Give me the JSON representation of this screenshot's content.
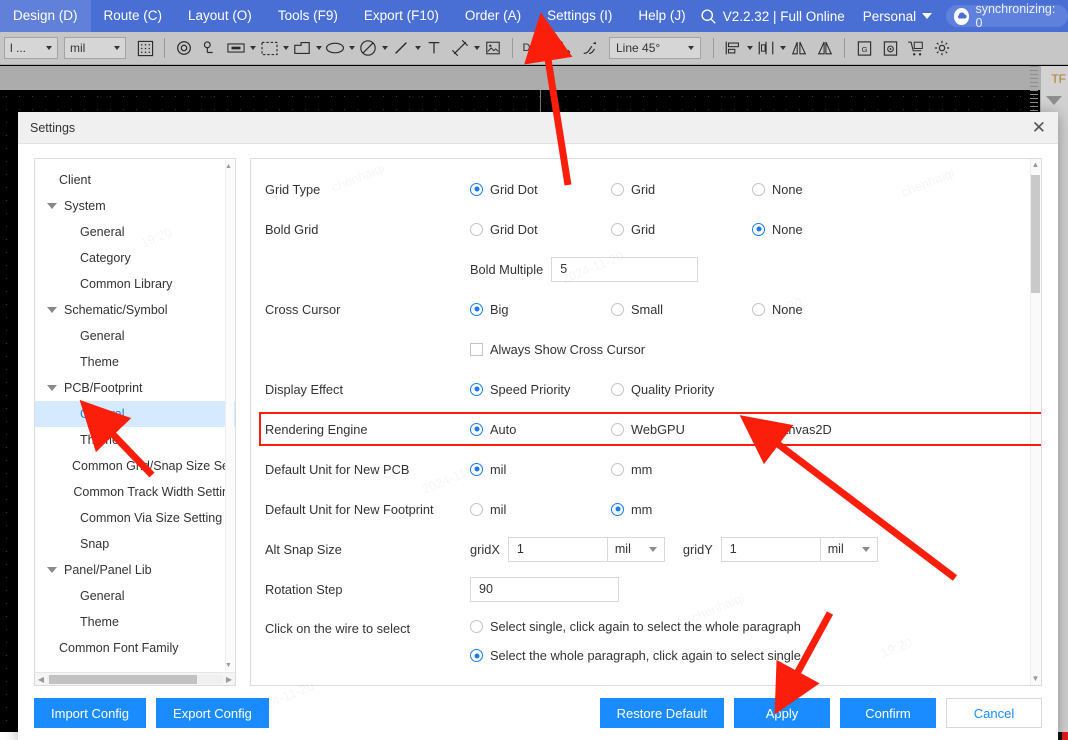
{
  "menubar": {
    "items": [
      {
        "label": "Design (D)",
        "name": "menu-design"
      },
      {
        "label": "Route (C)",
        "name": "menu-route"
      },
      {
        "label": "Layout (O)",
        "name": "menu-layout"
      },
      {
        "label": "Tools (F9)",
        "name": "menu-tools"
      },
      {
        "label": "Export (F10)",
        "name": "menu-export"
      },
      {
        "label": "Order (A)",
        "name": "menu-order"
      },
      {
        "label": "Settings (I)",
        "name": "menu-settings"
      },
      {
        "label": "Help (J)",
        "name": "menu-help"
      }
    ],
    "search_icon": "search-icon",
    "version": "V2.2.32 | Full Online",
    "account": "Personal",
    "sync_status": "synchronizing: 0",
    "accent": "#4a6fd4"
  },
  "toolbar": {
    "layer_select": "l ...",
    "unit_select": "mil",
    "line_mode": "Line 45°",
    "drc_label": "DRC",
    "icons": [
      "grid-icon",
      "via-icon",
      "pad-icon",
      "rect-dashed-icon",
      "polygon-icon",
      "ellipse-icon",
      "no-entry-icon",
      "line-icon",
      "text-icon",
      "dimension-icon"
    ]
  },
  "right_rail": {
    "tab_label": "TF"
  },
  "dialog": {
    "title": "Settings",
    "close_icon": "close-icon",
    "tree": [
      {
        "label": "Client",
        "level": 0,
        "expandable": false,
        "selected": false
      },
      {
        "label": "System",
        "level": 0,
        "expandable": true,
        "selected": false
      },
      {
        "label": "General",
        "level": 1,
        "expandable": false,
        "selected": false
      },
      {
        "label": "Category",
        "level": 1,
        "expandable": false,
        "selected": false
      },
      {
        "label": "Common Library",
        "level": 1,
        "expandable": false,
        "selected": false
      },
      {
        "label": "Schematic/Symbol",
        "level": 0,
        "expandable": true,
        "selected": false
      },
      {
        "label": "General",
        "level": 1,
        "expandable": false,
        "selected": false
      },
      {
        "label": "Theme",
        "level": 1,
        "expandable": false,
        "selected": false
      },
      {
        "label": "PCB/Footprint",
        "level": 0,
        "expandable": true,
        "selected": false
      },
      {
        "label": "General",
        "level": 1,
        "expandable": false,
        "selected": true
      },
      {
        "label": "Theme",
        "level": 1,
        "expandable": false,
        "selected": false
      },
      {
        "label": "Common Grid/Snap Size Se",
        "level": 1,
        "expandable": false,
        "selected": false
      },
      {
        "label": "Common Track Width Settin",
        "level": 1,
        "expandable": false,
        "selected": false
      },
      {
        "label": "Common Via Size Setting",
        "level": 1,
        "expandable": false,
        "selected": false
      },
      {
        "label": "Snap",
        "level": 1,
        "expandable": false,
        "selected": false
      },
      {
        "label": "Panel/Panel Lib",
        "level": 0,
        "expandable": true,
        "selected": false
      },
      {
        "label": "General",
        "level": 1,
        "expandable": false,
        "selected": false
      },
      {
        "label": "Theme",
        "level": 1,
        "expandable": false,
        "selected": false
      },
      {
        "label": "Common Font Family",
        "level": 0,
        "expandable": false,
        "selected": false
      }
    ],
    "settings": {
      "grid_type": {
        "label": "Grid Type",
        "options": [
          "Grid Dot",
          "Grid",
          "None"
        ],
        "selected": "Grid Dot"
      },
      "bold_grid": {
        "label": "Bold Grid",
        "options": [
          "Grid Dot",
          "Grid",
          "None"
        ],
        "selected": "None"
      },
      "bold_multiple": {
        "label": "Bold Multiple",
        "value": "5"
      },
      "cross_cursor": {
        "label": "Cross Cursor",
        "options": [
          "Big",
          "Small",
          "None"
        ],
        "selected": "Big"
      },
      "always_show_cross_cursor": {
        "label": "Always Show Cross Cursor",
        "checked": false
      },
      "display_effect": {
        "label": "Display Effect",
        "options": [
          "Speed Priority",
          "Quality Priority"
        ],
        "selected": "Speed Priority"
      },
      "rendering_engine": {
        "label": "Rendering Engine",
        "options": [
          "Auto",
          "WebGPU",
          "Canvas2D"
        ],
        "selected": "Auto",
        "highlight_color": "#fb1e0b"
      },
      "default_unit_pcb": {
        "label": "Default Unit for New PCB",
        "options": [
          "mil",
          "mm"
        ],
        "selected": "mil"
      },
      "default_unit_footprint": {
        "label": "Default Unit for New Footprint",
        "options": [
          "mil",
          "mm"
        ],
        "selected": "mm"
      },
      "alt_snap_size": {
        "label": "Alt Snap Size",
        "gridx_label": "gridX",
        "gridx_value": "1",
        "gridx_unit": "mil",
        "gridy_label": "gridY",
        "gridy_value": "1",
        "gridy_unit": "mil"
      },
      "rotation_step": {
        "label": "Rotation Step",
        "value": "90"
      },
      "click_wire_select": {
        "label": "Click on the wire to select",
        "options": [
          "Select single, click again to select the whole paragraph",
          "Select the whole paragraph, click again to select single"
        ],
        "selected": "Select the whole paragraph, click again to select single"
      }
    },
    "footer": {
      "import_config": "Import Config",
      "export_config": "Export Config",
      "restore_default": "Restore Default",
      "apply": "Apply",
      "confirm": "Confirm",
      "cancel": "Cancel"
    }
  },
  "watermarks": [
    "chenhaiqi",
    "2024-11-20",
    "19:20"
  ]
}
